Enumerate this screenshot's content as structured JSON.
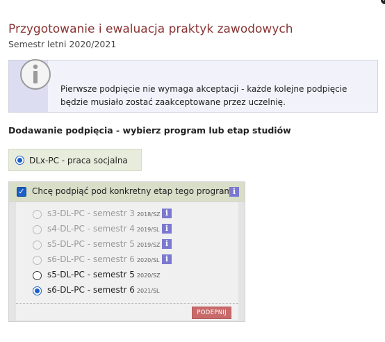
{
  "window": {
    "close_glyph": "✕"
  },
  "page": {
    "title": "Przygotowanie i ewaluacja praktyk zawodowych",
    "semester": "Semestr letni 2020/2021"
  },
  "info_box": {
    "icon": "info-icon",
    "message": "Pierwsze podpięcie nie wymaga akceptacji - każde kolejne podpięcie będzie musiało zostać zaakceptowane przez uczelnię."
  },
  "section": {
    "heading": "Dodawanie podpięcia - wybierz program lub etap studiów"
  },
  "program": {
    "label": "DLx-PC - praca socjalna",
    "selected": true
  },
  "stage_panel": {
    "checkbox_label": "Chcę podpiąć pod konkretny etap tego programu",
    "checkbox_checked": true,
    "info_glyph": "i",
    "stages": [
      {
        "name": "s3-DL-PC - semestr 3",
        "tag": "2018/SZ",
        "enabled": false,
        "selected": false,
        "has_info": true
      },
      {
        "name": "s4-DL-PC - semestr 4",
        "tag": "2019/SL",
        "enabled": false,
        "selected": false,
        "has_info": true
      },
      {
        "name": "s5-DL-PC - semestr 5",
        "tag": "2019/SZ",
        "enabled": false,
        "selected": false,
        "has_info": true
      },
      {
        "name": "s6-DL-PC - semestr 6",
        "tag": "2020/SL",
        "enabled": false,
        "selected": false,
        "has_info": true
      },
      {
        "name": "s5-DL-PC - semestr 5",
        "tag": "2020/SZ",
        "enabled": true,
        "selected": false,
        "has_info": false
      },
      {
        "name": "s6-DL-PC - semestr 6",
        "tag": "2021/SL",
        "enabled": true,
        "selected": true,
        "has_info": false
      }
    ],
    "submit_label": "PODEPNIJ"
  },
  "colors": {
    "title": "#8a3434",
    "accent_blue": "#1a5fc8",
    "info_chip": "#7b78d0",
    "submit_button": "#c96a6a"
  }
}
